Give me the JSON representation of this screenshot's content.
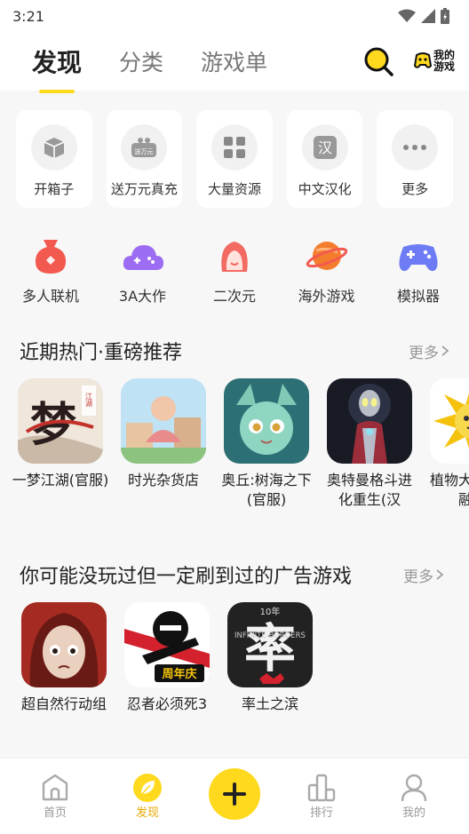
{
  "status_bar": {
    "time": "3:21"
  },
  "top_tabs": [
    {
      "label": "发现",
      "active": true
    },
    {
      "label": "分类",
      "active": false
    },
    {
      "label": "游戏单",
      "active": false
    }
  ],
  "my_games": {
    "line1": "我的",
    "line2": "游戏"
  },
  "feature_cards": [
    {
      "label": "开箱子",
      "icon": "box-icon"
    },
    {
      "label": "送万元真充",
      "icon": "gift-icon",
      "badge": "送万元"
    },
    {
      "label": "大量资源",
      "icon": "grid-icon"
    },
    {
      "label": "中文汉化",
      "icon": "chinese-icon",
      "glyph": "汉"
    },
    {
      "label": "更多",
      "icon": "more-icon"
    }
  ],
  "categories": [
    {
      "label": "多人联机",
      "icon": "bag-icon",
      "color": "#f2594f"
    },
    {
      "label": "3A大作",
      "icon": "cloud-gamepad-icon",
      "color": "#9c6cf2"
    },
    {
      "label": "二次元",
      "icon": "anime-girl-icon",
      "color": "#f36a63"
    },
    {
      "label": "海外游戏",
      "icon": "planet-icon",
      "color": "#f37d2c"
    },
    {
      "label": "模拟器",
      "icon": "gamepad-icon",
      "color": "#6d7cf5"
    }
  ],
  "section1": {
    "title": "近期热门·重磅推荐",
    "more": "更多",
    "games": [
      {
        "name": "一梦江湖(官服)"
      },
      {
        "name": "时光杂货店"
      },
      {
        "name": "奥丘:树海之下(官服)"
      },
      {
        "name": "奥特曼格斗进化重生(汉"
      },
      {
        "name": "植物大战僵尸融合"
      }
    ]
  },
  "section2": {
    "title": "你可能没玩过但一定刷到过的广告游戏",
    "more": "更多",
    "games": [
      {
        "name": "超自然行动组"
      },
      {
        "name": "忍者必须死3"
      },
      {
        "name": "率土之滨"
      }
    ]
  },
  "thumb_text": {
    "jianghu": "梦",
    "jianghu_tag": "江湖",
    "ninja_badge": "周年庆",
    "shuaitu_top": "10年",
    "shuaitu_big": "率",
    "shuaitu_en": "INFINITE BORDERS"
  },
  "bottom_nav": [
    {
      "label": "首页",
      "active": false
    },
    {
      "label": "发现",
      "active": true
    },
    {
      "label": "排行",
      "active": false
    },
    {
      "label": "我的",
      "active": false
    }
  ],
  "colors": {
    "accent": "#ffd91e",
    "accent_text": "#e6a800"
  }
}
